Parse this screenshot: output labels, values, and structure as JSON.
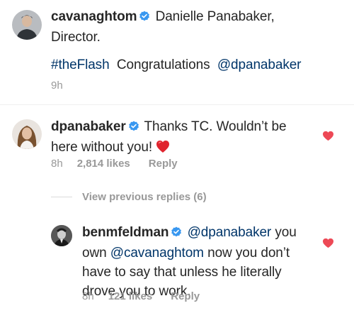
{
  "caption": {
    "username": "cavanaghtom",
    "text_line1": "Danielle Panabaker,",
    "text_line2": "Director.",
    "hashtag": "#theFlash",
    "congrats": "Congratulations",
    "mention": "@dpanabaker",
    "time": "9h"
  },
  "comment1": {
    "username": "dpanabaker",
    "text_line1": "Thanks TC. Wouldn’t be",
    "text_line2": "here without you!",
    "emoji": "❤️",
    "time": "8h",
    "likes": "2,814 likes",
    "reply": "Reply"
  },
  "view_previous": "View previous replies (6)",
  "comment2": {
    "username": "benmfeldman",
    "mention1": "@dpanabaker",
    "text1": "you",
    "text2a": "own",
    "mention2": "@cavanaghtom",
    "text2b": "now you don’t",
    "text3": "have to say that unless he literally",
    "text4": "drove you to work.",
    "time": "8h",
    "likes": "121 likes",
    "reply": "Reply"
  },
  "colors": {
    "text": "#262626",
    "link": "#003569",
    "meta": "#999999",
    "verified": "#3897f0",
    "heart": "#ed4956"
  },
  "icons": [
    "verified-badge-icon",
    "heart-icon"
  ]
}
